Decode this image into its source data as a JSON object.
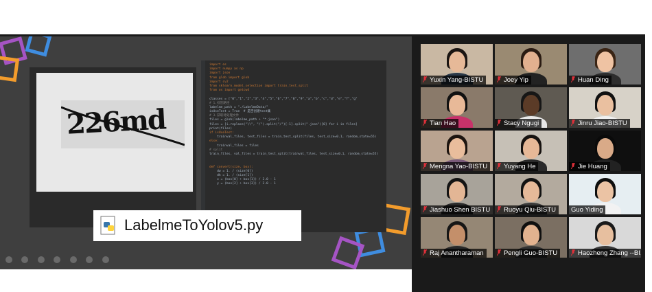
{
  "shared_screen": {
    "captcha_text": "226md",
    "file_label": "LabelmeToYolov5.py",
    "code_lines": [
      "import os",
      "import numpy as np",
      "import json",
      "from glob import glob",
      "import cv2",
      "from sklearn.model_selection import train_test_split",
      "from os import getcwd",
      "",
      "classes = [\"0\",\"1\",\"2\",\"3\",\"4\",\"5\",\"6\",\"7\",\"8\",\"9\",\"a\",\"b\",\"c\",\"d\",\"e\",\"f\",\"g\"",
      "# 1.标签路径",
      "labelme_path = \"./LabelmeData/\"",
      "isUseTest = True  # 是否创建test集",
      "# 3.获取待处理文件",
      "files = glob(labelme_path + \"*.json\")",
      "files = [i.replace(\"\\\\\", \"/\").split(\"/\")[-1].split(\".json\")[0] for i in files]",
      "print(files)",
      "if isUseTest:",
      "    trainval_files, test_files = train_test_split(files, test_size=0.1, random_state=55)",
      "else:",
      "    trainval_files = files",
      "# split",
      "train_files, val_files = train_test_split(trainval_files, test_size=0.1, random_state=55)",
      "",
      "",
      "def convert(size, box):",
      "    dw = 1. / (size[0])",
      "    dh = 1. / (size[1])",
      "    x = (box[0] + box[1]) / 2.0 - 1",
      "    y = (box[2] + box[3]) / 2.0 - 1"
    ]
  },
  "participants": [
    {
      "name": "Yuxin Yang-BISTU",
      "muted": true
    },
    {
      "name": "Joey Yip",
      "muted": true
    },
    {
      "name": "Huan Ding",
      "muted": true
    },
    {
      "name": "Tian Hao",
      "muted": true
    },
    {
      "name": "Stacy Ngugi",
      "muted": true
    },
    {
      "name": "Jinru Jiao-BISTU",
      "muted": true
    },
    {
      "name": "Mengna Yao-BISTU",
      "muted": true
    },
    {
      "name": "Yuyang He",
      "muted": true
    },
    {
      "name": "Jie Huang",
      "muted": true
    },
    {
      "name": "Jiashuo Shen BISTU",
      "muted": true
    },
    {
      "name": "Ruoyu Qiu-BISTU",
      "muted": true
    },
    {
      "name": "Guo Yiding",
      "muted": false,
      "active_speaker": true
    },
    {
      "name": "Raj Anantharaman",
      "muted": true
    },
    {
      "name": "Pengli Guo-BISTU",
      "muted": true
    },
    {
      "name": "Haozheng Zhang --BI...",
      "muted": true
    }
  ],
  "colors": {
    "active_speaker_border": "#8ccf5d",
    "muted_icon": "#e0303a"
  }
}
